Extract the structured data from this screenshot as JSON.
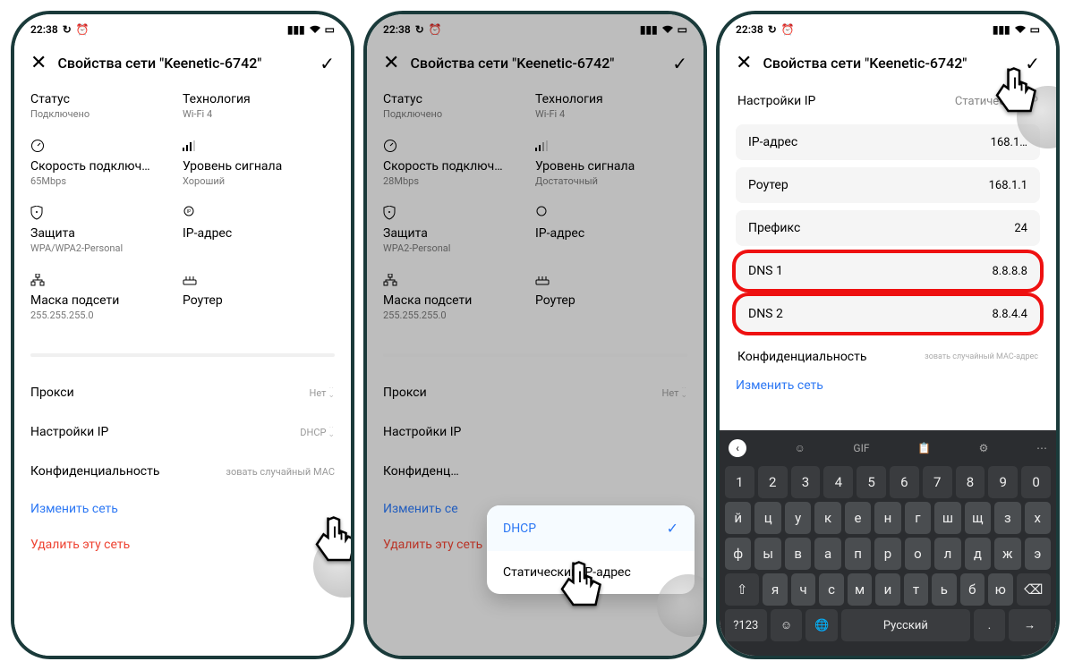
{
  "status_time": "22:38",
  "title": "Свойства сети \"Keenetic-6742\"",
  "screen1": {
    "status_label": "Статус",
    "status_value": "Подключено",
    "tech_label": "Технология",
    "tech_value": "Wi-Fi 4",
    "speed_label": "Скорость подключ…",
    "speed_value": "65Mbps",
    "signal_label": "Уровень сигнала",
    "signal_value": "Хороший",
    "sec_label": "Защита",
    "sec_value": "WPA/WPA2-Personal",
    "ip_label": "IP-адрес",
    "ip_value": "",
    "mask_label": "Маска подсети",
    "mask_value": "255.255.255.0",
    "router_label": "Роутер",
    "router_value": "",
    "proxy_label": "Прокси",
    "proxy_value": "Нет",
    "ipset_label": "Настройки IP",
    "ipset_value": "DHCP",
    "priv_label": "Конфиденциальность",
    "priv_value": "зовать случайный MAC",
    "change": "Изменить сеть",
    "delete": "Удалить эту сеть"
  },
  "screen2": {
    "status_label": "Статус",
    "status_value": "Подключено",
    "tech_label": "Технология",
    "tech_value": "Wi-Fi 4",
    "speed_label": "Скорость подключ…",
    "speed_value": "28Mbps",
    "signal_label": "Уровень сигнала",
    "signal_value": "Достаточный",
    "sec_label": "Защита",
    "sec_value": "WPA2-Personal",
    "ip_label": "IP-адрес",
    "mask_label": "Маска подсети",
    "mask_value": "255.255.255.0",
    "router_label": "Роутер",
    "proxy_label": "Прокси",
    "proxy_value": "Нет",
    "ipset_label": "Настройки IP",
    "priv_label": "Конфиденц…",
    "change": "Изменить се",
    "delete": "Удалить эту сеть",
    "popup_opt1": "DHCP",
    "popup_opt2": "Статический IP-адрес"
  },
  "screen3": {
    "ipset_label": "Настройки IP",
    "ipset_value": "Статический IP",
    "ip_label": "IP-адрес",
    "ip_value": "168.1…",
    "router_label": "Роутер",
    "router_value": "168.1.1",
    "prefix_label": "Префикс",
    "prefix_value": "24",
    "dns1_label": "DNS 1",
    "dns1_value": "8.8.8.8",
    "dns2_label": "DNS 2",
    "dns2_value": "8.8.4.4",
    "priv_label": "Конфиденциальность",
    "priv_value": "зовать случайный MAC-адрес",
    "change": "Изменить сеть",
    "kb_lang": "Русский",
    "kb_123": "?123",
    "kb_gif": "GIF"
  }
}
